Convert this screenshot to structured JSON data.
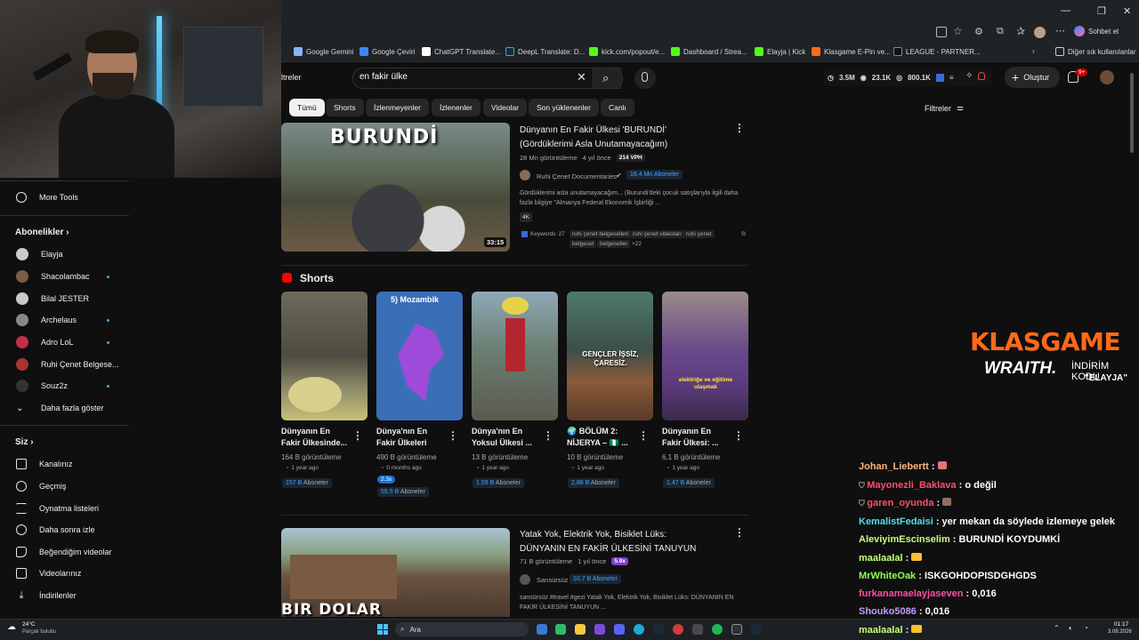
{
  "browser": {
    "chat_button": "Sohbet et",
    "bookmarks": [
      {
        "label": "Google Gemini",
        "color": "#8ab4f8"
      },
      {
        "label": "Google Çeviri",
        "color": "#4285f4"
      },
      {
        "label": "ChatGPT Translate...",
        "color": "#ffffff"
      },
      {
        "label": "DeepL Translate: D...",
        "color": "#0f2b46"
      },
      {
        "label": "kick.com/popout/e...",
        "color": "#53fc18"
      },
      {
        "label": "Dashboard / Strea...",
        "color": "#53fc18"
      },
      {
        "label": "Elayja | Kick",
        "color": "#53fc18"
      },
      {
        "label": "Klasgame E-Pin ve...",
        "color": "#ff6a1a"
      },
      {
        "label": "LEAGUE - PARTNER...",
        "color": "#111111"
      }
    ],
    "other_bookmarks": "Diğer sık kullanılanlar"
  },
  "youtube": {
    "filters_partial": "ltreler",
    "search_query": "en fakir ülke",
    "stats": {
      "a": "3.5M",
      "b": "23.1K",
      "c": "800.1K"
    },
    "create_label": "Oluştur",
    "notif_count": "9+",
    "chips": [
      "Tümü",
      "Shorts",
      "İzlenmeyenler",
      "İzlenenler",
      "Videolar",
      "Son yüklenenler",
      "Canlı"
    ],
    "filters_label": "Filtreler",
    "video1": {
      "title_line1": "Dünyanın En Fakir Ülkesi 'BURUNDİ'",
      "title_line2": "(Gördüklerimi Asla Unutamayacağım)",
      "views": "28 Mn görüntüleme",
      "age": "4 yıl önce",
      "vph": "214 VPH",
      "channel": "Ruhi Çenet Documentaries",
      "subs": "18,4 Mn Aboneler",
      "desc_line1": "Gördüklerimi asla unutamayacağım... (Burundi'deki çocuk satışlarıyla ilgili daha",
      "desc_line2": "fazla bilgiye \"Almanya Federal Ekonomik İşbirliği ...",
      "badge": "4K",
      "keywords_label": "Keywords",
      "keywords_count": "27",
      "tags": [
        "ruhi çenet belgeselleri",
        "ruhi çenet videoları",
        "ruhi çenet",
        "belgesel",
        "belgeseller"
      ],
      "tags_more": "+22",
      "duration": "33:15",
      "thumb_text": "BURUNDİ"
    },
    "shorts_heading": "Shorts",
    "shorts": [
      {
        "title1": "Dünyanın En",
        "title2": "Fakir Ülkesinde...",
        "views": "164 B görüntüleme",
        "age": "1 year ago",
        "subs_num": "157 B",
        "subs_label": "Aboneler",
        "thumb_text": ""
      },
      {
        "title1": "Dünya'nın En",
        "title2": "Fakir Ülkeleri",
        "views": "490 B görüntüleme",
        "age": "0 months ago",
        "subs_num": "55,5 B",
        "subs_label": "Aboneler",
        "multiplier": "2.3x",
        "thumb_text": "5) Mozambik"
      },
      {
        "title1": "Dünya'nın En",
        "title2": "Yoksul Ülkesi ...",
        "views": "13 B görüntüleme",
        "age": "1 year ago",
        "subs_num": "1,59 B",
        "subs_label": "Aboneler",
        "thumb_text": ""
      },
      {
        "title1": "🌍 BÖLÜM 2:",
        "title2": "NİJERYA – 🇳🇬 ...",
        "views": "10 B görüntüleme",
        "age": "1 year ago",
        "subs_num": "2,88 B",
        "subs_label": "Aboneler",
        "thumb_text": "GENÇLER İŞSİZ, ÇARESİZ."
      },
      {
        "title1": "Dünyanın En",
        "title2": "Fakir Ülkesi: ...",
        "views": "6,1 B görüntüleme",
        "age": "1 year ago",
        "subs_num": "1,47 B",
        "subs_label": "Aboneler",
        "thumb_text": "elektriğe ve eğitime ulaşmak"
      }
    ],
    "video2": {
      "title_line1": "Yatak Yok, Elektrik Yok, Bisiklet Lüks:",
      "title_line2": "DÜNYANIN EN FAKİR ÜLKESİNİ TANUYUN",
      "views": "71 B görüntüleme",
      "age": "1 yıl önce",
      "multiplier": "5.9x",
      "channel": "Sansürsüz",
      "subs": "10,7 B Aboneler",
      "desc_line1": "sansürsüz #travel #gezi Yatak Yok, Elektrik Yok, Bisiklet Lüks: DÜNYANIN EN",
      "desc_line2": "FAKİR ÜLKESİNİ TANUYUN ...",
      "thumb_text": "BIR DOLAR"
    }
  },
  "sidebar": {
    "more_tools": "More Tools",
    "subs_heading": "Abonelikler",
    "subscriptions": [
      {
        "name": "Elayja",
        "live": false,
        "color": "#ccc"
      },
      {
        "name": "Shacolambac",
        "live": true,
        "color": "#7a5c4a"
      },
      {
        "name": "Bilal JESTER",
        "live": false,
        "color": "#c9c9c9"
      },
      {
        "name": "Archelaus",
        "live": true,
        "color": "#888"
      },
      {
        "name": "Adro LoL",
        "live": true,
        "color": "#c0304a"
      },
      {
        "name": "Ruhi Çenet Belgese...",
        "live": false,
        "color": "#a33"
      },
      {
        "name": "Souz2z",
        "live": true,
        "color": "#333"
      }
    ],
    "show_more": "Daha fazla göster",
    "you_heading": "Siz",
    "you_items": [
      "Kanalınız",
      "Geçmiş",
      "Oynatma listeleri",
      "Daha sonra izle",
      "Beğendiğim videolar",
      "Videolarınız",
      "İndirilenler"
    ]
  },
  "overlay": {
    "brand_part1": "KLAS",
    "brand_part2": "GAME",
    "promo_brand": "WRAITH.",
    "promo_text": "İNDİRİM KODU",
    "promo_code": "\"ELAYJA\"",
    "chat": [
      {
        "user": "Johan_Liebertt",
        "msg": "",
        "color": "#ffb27a"
      },
      {
        "user": "Mayonezli_Baklava",
        "msg": "o değil",
        "color": "#ff4d6d"
      },
      {
        "user": "garen_oyunda",
        "msg": "",
        "color": "#ff4d6d"
      },
      {
        "user": "KemalistFedaisi",
        "msg": "yer mekan da söylede izlemeye gelek",
        "color": "#4de0e6"
      },
      {
        "user": "AleviyimEscinselim",
        "msg": "BURUNDİ KOYDUMKİ",
        "color": "#c6ff7a"
      },
      {
        "user": "maalaalal",
        "msg": "",
        "color": "#c6ff7a"
      },
      {
        "user": "MrWhiteOak",
        "msg": "ISKGOHDOPISDGHGDS",
        "color": "#8dff5a"
      },
      {
        "user": "furkanamaelayjaseven",
        "msg": "0,016",
        "color": "#ff4da6"
      },
      {
        "user": "Shouko5086",
        "msg": "0,016",
        "color": "#c29dff"
      },
      {
        "user": "maalaalal",
        "msg": "",
        "color": "#c6ff7a"
      }
    ]
  },
  "taskbar": {
    "weather_temp": "24°C",
    "weather_desc": "Parçalı bulutlu",
    "search_label": "Ara",
    "time": "01:17",
    "date": "3.08.2026"
  }
}
